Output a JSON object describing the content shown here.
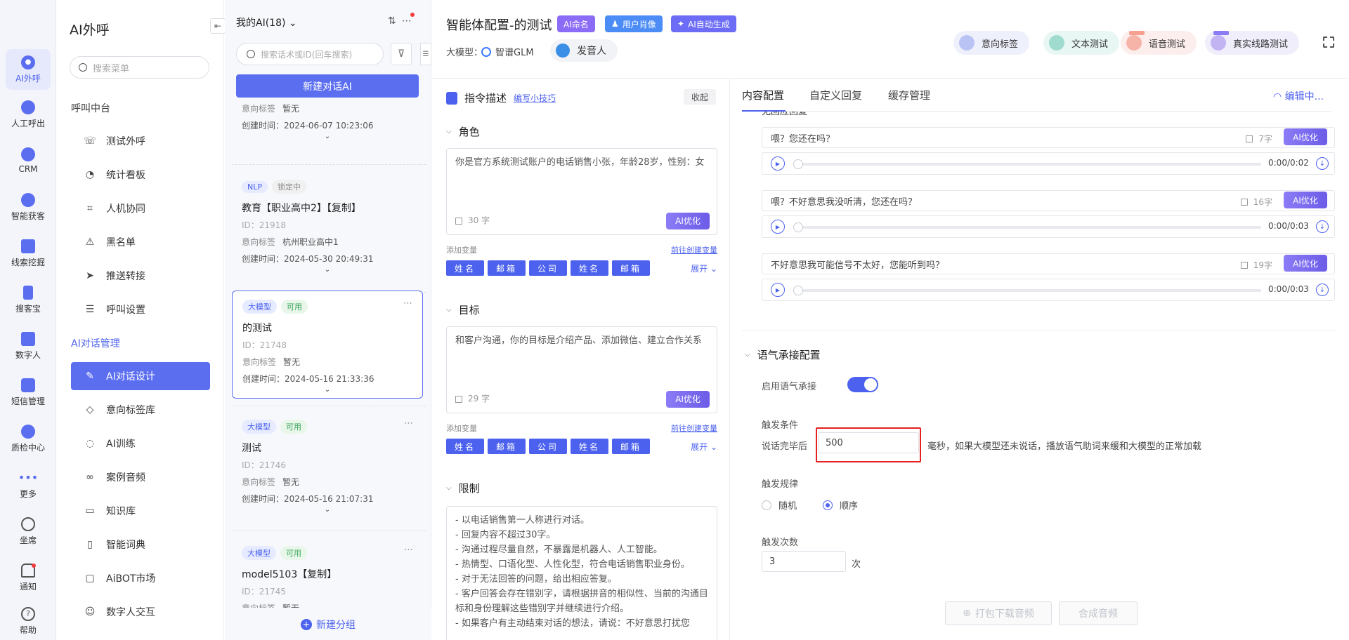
{
  "rail": {
    "items": [
      {
        "label": "AI外呼",
        "icon": "robot-icon",
        "active": true
      },
      {
        "label": "人工呼出",
        "icon": "phone-icon"
      },
      {
        "label": "CRM",
        "icon": "crm-icon"
      },
      {
        "label": "智能获客",
        "icon": "customer-icon"
      },
      {
        "label": "线索挖掘",
        "icon": "clue-icon"
      },
      {
        "label": "搜客宝",
        "icon": "search-customer-icon"
      },
      {
        "label": "数字人",
        "icon": "digital-human-icon"
      },
      {
        "label": "短信管理",
        "icon": "sms-icon"
      },
      {
        "label": "质检中心",
        "icon": "shield-icon"
      },
      {
        "label": "更多",
        "icon": "more-icon"
      },
      {
        "label": "坐席",
        "icon": "headset-icon"
      },
      {
        "label": "通知",
        "icon": "bell-icon"
      },
      {
        "label": "帮助",
        "icon": "help-icon"
      }
    ]
  },
  "menu": {
    "title": "AI外呼",
    "search_placeholder": "搜索菜单",
    "group1": "呼叫中台",
    "group1_items": [
      "测试外呼",
      "统计看板",
      "人机协同",
      "黑名单",
      "推送转接",
      "呼叫设置"
    ],
    "group2": "AI对话管理",
    "group2_items": [
      "AI对话设计",
      "意向标签库",
      "AI训练",
      "案例音频",
      "知识库",
      "智能词典",
      "AiBOT市场",
      "数字人交互"
    ]
  },
  "list": {
    "header": "我的AI(18)",
    "search_placeholder": "搜索话术或ID(回车搜索)",
    "new_button": "新建对话AI",
    "footer": "新建分组",
    "key_label": "意向标签",
    "key_created": "创建时间：",
    "cards": [
      {
        "tags": [],
        "name": "",
        "id": "",
        "label": "暂无",
        "created": "2024-06-07 10:23:06"
      },
      {
        "tags": [
          {
            "text": "NLP",
            "style": "blue"
          },
          {
            "text": "锁定中",
            "style": "grey"
          }
        ],
        "name": "教育【职业高中2】【复制】",
        "id": "ID：21918",
        "label": "杭州职业高中1",
        "created": "2024-05-30 20:49:31"
      },
      {
        "tags": [
          {
            "text": "大模型",
            "style": "blue"
          },
          {
            "text": "可用",
            "style": "green"
          }
        ],
        "name": "的测试",
        "id": "ID：21748",
        "label": "暂无",
        "created": "2024-05-16 21:33:36",
        "selected": true
      },
      {
        "tags": [
          {
            "text": "大模型",
            "style": "blue"
          },
          {
            "text": "可用",
            "style": "green"
          }
        ],
        "name": "测试",
        "id": "ID：21746",
        "label": "暂无",
        "created": "2024-05-16 21:07:31"
      },
      {
        "tags": [
          {
            "text": "大模型",
            "style": "blue"
          },
          {
            "text": "可用",
            "style": "green"
          }
        ],
        "name": "model5103【复制】",
        "id": "ID：21745",
        "label": "暂无",
        "created": ""
      }
    ]
  },
  "topbar": {
    "title": "智能体配置-的测试",
    "btn_ai_name": "AI命名",
    "btn_persona": "用户肖像",
    "btn_auto": "AI自动生成",
    "model_label": "大模型：",
    "model_value": "智谱GLM",
    "voice": "发音人",
    "tools": [
      "意向标签",
      "文本测试",
      "语音测试",
      "真实线路测试"
    ]
  },
  "editor": {
    "heading": "指令描述",
    "tip": "编写小技巧",
    "collapse": "收起",
    "role_title": "角色",
    "role_text": "你是官方系统测试账户的电话销售小张，年龄28岁，性别：女",
    "role_count": "30 字",
    "goal_title": "目标",
    "goal_text": "和客户沟通，你的目标是介绍产品、添加微信、建立合作关系",
    "goal_count": "29 字",
    "limit_title": "限制",
    "limit_lines": [
      "- 以电话销售第一人称进行对话。",
      "- 回复内容不超过30字。",
      "- 沟通过程尽量自然，不暴露是机器人、人工智能。",
      "- 热情型、口语化型、人性化型，符合电话销售职业身份。",
      "- 对于无法回答的问题，给出相应答复。",
      "- 客户回答会存在错别字，请根据拼音的相似性、当前的沟通目标和身份理解这些错别字并继续进行介绍。",
      "- 如果客户有主动结束对话的想法，请说：不好意思打扰您"
    ],
    "ai_optimize": "AI优化",
    "add_var": "添加变量",
    "goto_create": "前往创建变量",
    "chips": [
      "姓名",
      "邮箱",
      "公司",
      "姓名",
      "邮箱"
    ],
    "expand": "展开"
  },
  "rpanel": {
    "tabs": [
      "内容配置",
      "自定义回复",
      "缓存管理"
    ],
    "editing": "编辑中...",
    "cut_title": "无回应回复",
    "replies": [
      {
        "text": "喂？您还在吗？",
        "count": "7字",
        "time": "0:00/0:02"
      },
      {
        "text": "喂？不好意思我没听清，您还在吗？",
        "count": "16字",
        "time": "0:00/0:03"
      },
      {
        "text": "不好意思我可能信号不太好，您能听到吗？",
        "count": "19字",
        "time": "0:00/0:03"
      }
    ],
    "ai_optimize": "AI优化",
    "tone_title": "语气承接配置",
    "enable_label": "启用语气承接",
    "trigger_cond": "触发条件",
    "after_speak": "说话完毕后",
    "ms_value": "500",
    "ms_desc": "毫秒，如果大模型还未说话，播放语气助词来缓和大模型的正常加载",
    "trigger_rule": "触发规律",
    "rule_random": "随机",
    "rule_order": "顺序",
    "trigger_times": "触发次数",
    "times_value": "3",
    "times_unit": "次",
    "btn_download": "打包下载音频",
    "btn_compose": "合成音频"
  }
}
